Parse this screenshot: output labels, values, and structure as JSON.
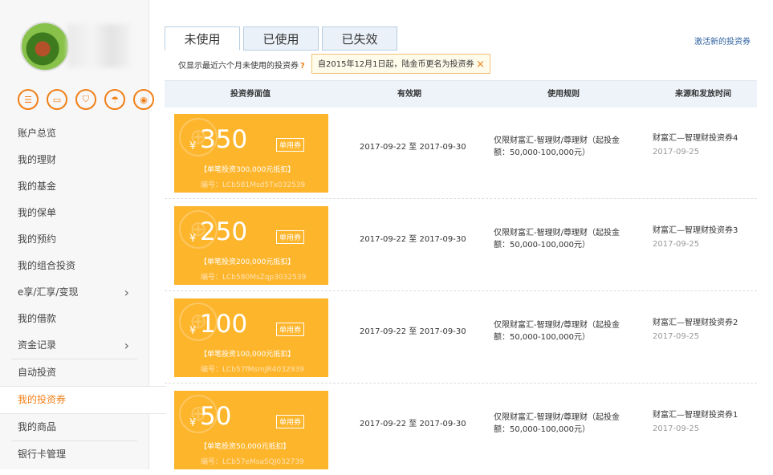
{
  "sidebar": {
    "quick_icons": [
      "list-icon",
      "card-icon",
      "shield-icon",
      "umbrella-icon",
      "bag-icon"
    ],
    "items": [
      {
        "label": "账户总览"
      },
      {
        "label": "我的理财"
      },
      {
        "label": "我的基金"
      },
      {
        "label": "我的保单"
      },
      {
        "label": "我的预约"
      },
      {
        "label": "我的组合投资"
      },
      {
        "label": "e享/汇享/变现"
      },
      {
        "label": "我的借款"
      },
      {
        "label": "资金记录"
      },
      {
        "label": "自动投资"
      },
      {
        "label": "我的投资券"
      },
      {
        "label": "我的商品"
      },
      {
        "label": "银行卡管理"
      }
    ]
  },
  "tabs": [
    {
      "label": "未使用"
    },
    {
      "label": "已使用"
    },
    {
      "label": "已失效"
    }
  ],
  "activate_link": "激活新的投资券",
  "notice": "仅显示最近六个月未使用的投资券",
  "notice_help": "?",
  "tip": {
    "text": "自2015年12月1日起，陆金币更名为投资券",
    "close": "×"
  },
  "table": {
    "headers": [
      "投资券面值",
      "有效期",
      "使用规则",
      "来源和发放时间"
    ],
    "rows": [
      {
        "currency": "¥",
        "amount": "350",
        "type": "单用券",
        "limit": "【单笔投资300,000元抵扣】",
        "code": "编号：LCb581Msd5Tx032539",
        "period": "2017-09-22 至 2017-09-30",
        "rule": "仅限财富汇-智理财/尊理财（起投金额：50,000-100,000元）",
        "source": "财富汇—智理财投资券4",
        "date": "2017-09-25"
      },
      {
        "currency": "¥",
        "amount": "250",
        "type": "单用券",
        "limit": "【单笔投资200,000元抵扣】",
        "code": "编号：LCb580MsZqp3032539",
        "period": "2017-09-22 至 2017-09-30",
        "rule": "仅限财富汇-智理财/尊理财（起投金额：50,000-100,000元）",
        "source": "财富汇—智理财投资券3",
        "date": "2017-09-25"
      },
      {
        "currency": "¥",
        "amount": "100",
        "type": "单用券",
        "limit": "【单笔投资100,000元抵扣】",
        "code": "编号：LCb57fMsmJR4032939",
        "period": "2017-09-22 至 2017-09-30",
        "rule": "仅限财富汇-智理财/尊理财（起投金额：50,000-100,000元）",
        "source": "财富汇—智理财投资券2",
        "date": "2017-09-25"
      },
      {
        "currency": "¥",
        "amount": "50",
        "type": "单用券",
        "limit": "【单笔投资50,000元抵扣】",
        "code": "编号：LCb57eMsaSQJ032739",
        "period": "2017-09-22 至 2017-09-30",
        "rule": "仅限财富汇-智理财/尊理财（起投金额：50,000-100,000元）",
        "source": "财富汇—智理财投资券1",
        "date": "2017-09-25"
      }
    ]
  },
  "colors": {
    "accent": "#f08019",
    "coupon": "#fdb52c",
    "link": "#2c5f9e"
  }
}
